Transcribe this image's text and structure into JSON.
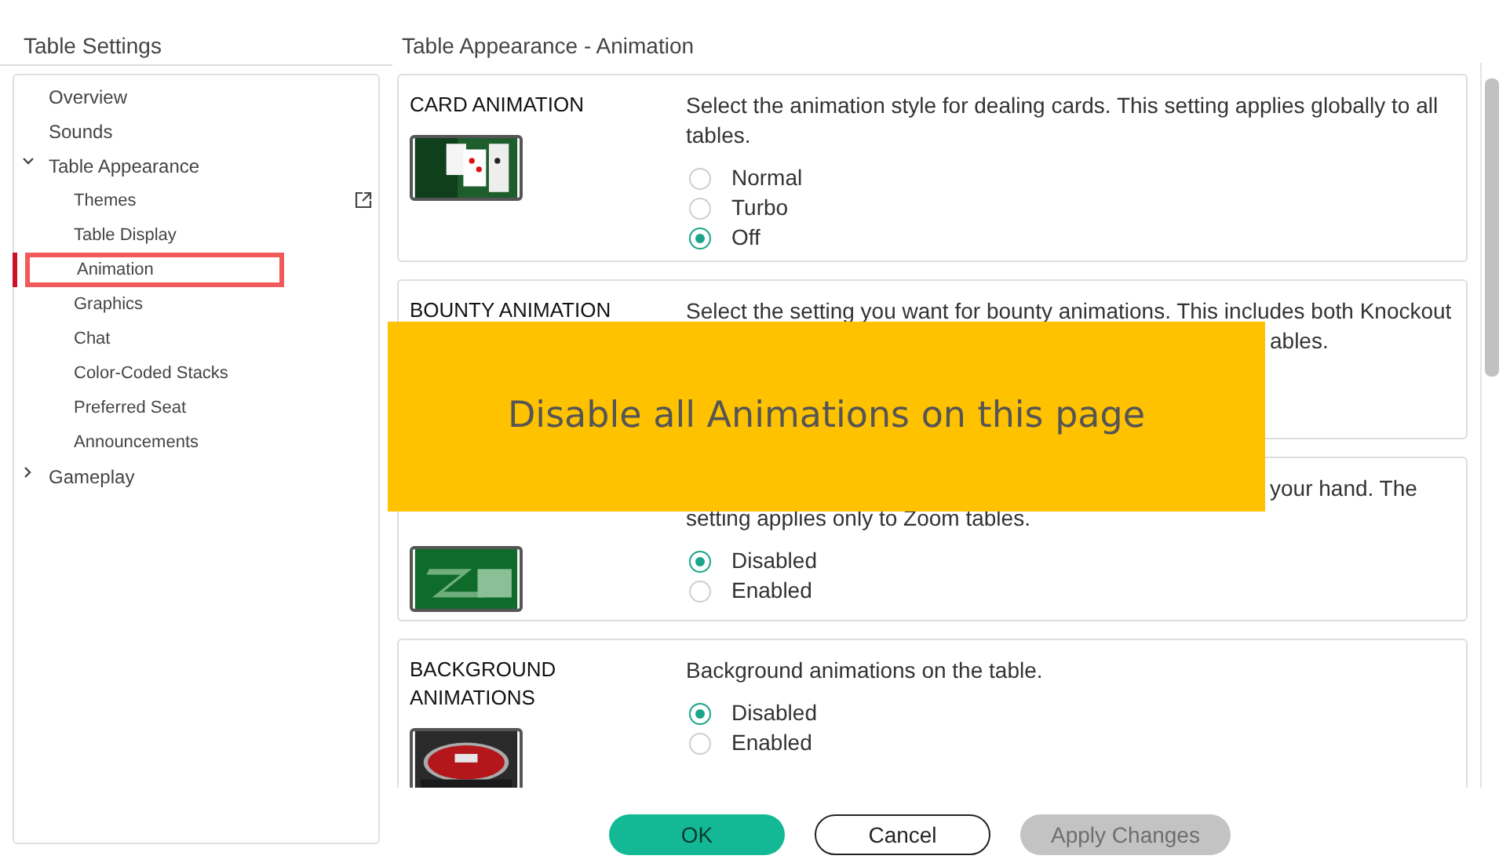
{
  "header": {
    "title": "Table Settings"
  },
  "sidebar": {
    "items": [
      {
        "label": "Overview",
        "selected": false
      },
      {
        "label": "Sounds",
        "selected": false
      },
      {
        "label": "Table Appearance",
        "selected": false,
        "expanded": true,
        "children": [
          {
            "label": "Themes",
            "selected": false,
            "external": true
          },
          {
            "label": "Table Display",
            "selected": false,
            "external": false
          },
          {
            "label": "Animation",
            "selected": true,
            "external": false
          },
          {
            "label": "Graphics",
            "selected": false,
            "external": false
          },
          {
            "label": "Chat",
            "selected": false,
            "external": false
          },
          {
            "label": "Color-Coded Stacks",
            "selected": false,
            "external": false
          },
          {
            "label": "Preferred Seat",
            "selected": false,
            "external": false
          },
          {
            "label": "Announcements",
            "selected": false,
            "external": false
          }
        ]
      },
      {
        "label": "Gameplay",
        "selected": false,
        "expanded": false
      }
    ]
  },
  "content": {
    "title": "Table Appearance - Animation",
    "sections": [
      {
        "title": "CARD ANIMATION",
        "picture": {
          "kind": "picture"
        },
        "lines": [
          {
            "kind": "full",
            "text": "Select the animation style for dealing cards. This setting applies globally to all tables."
          }
        ],
        "options": [
          {
            "label": "Normal",
            "selected": false
          },
          {
            "label": "Turbo",
            "selected": false
          },
          {
            "label": "Off",
            "selected": true
          }
        ]
      },
      {
        "title": "BOUNTY ANIMATION",
        "lines": [
          {
            "kind": "full",
            "text": "Select the setting you want for bounty animations. This includes both Knockout"
          },
          {
            "kind": "tail",
            "text": "ables."
          }
        ]
      },
      {
        "picture": {
          "kind": "picture"
        },
        "lines": [
          {
            "kind": "tail",
            "text": "your hand. The"
          },
          {
            "kind": "full",
            "text": "setting applies only to Zoom tables."
          }
        ],
        "options": [
          {
            "label": "Disabled",
            "selected": true
          },
          {
            "label": "Enabled",
            "selected": false
          }
        ]
      },
      {
        "title": "BACKGROUND ANIMATIONS",
        "picture": {
          "kind": "picture"
        },
        "lines": [
          {
            "kind": "full",
            "text": "Background animations on the table."
          }
        ],
        "options": [
          {
            "label": "Disabled",
            "selected": true
          },
          {
            "label": "Enabled",
            "selected": false
          }
        ]
      }
    ]
  },
  "callout": {
    "text": "Disable all Animations on this page"
  },
  "buttons": [
    {
      "label": "OK",
      "kind": "primary",
      "disabled": false
    },
    {
      "label": "Cancel",
      "kind": "outline",
      "disabled": false
    },
    {
      "label": "Apply Changes",
      "kind": "primary",
      "disabled": true
    }
  ]
}
